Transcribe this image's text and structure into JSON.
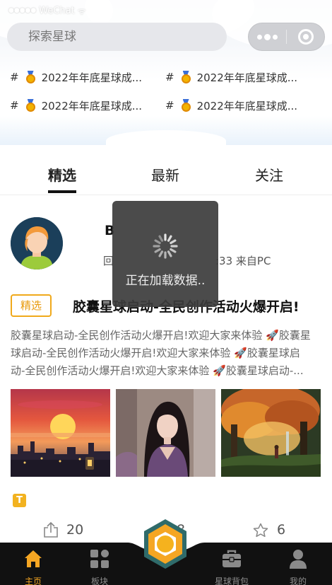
{
  "status_bar": {
    "signal": "●●●●●",
    "carrier": "WeChat",
    "wifi": "ᯤ"
  },
  "search": {
    "placeholder": "探索星球"
  },
  "topics": [
    {
      "hash": "#",
      "text": "2022年年底星球成..."
    },
    {
      "hash": "#",
      "text": "2022年年底星球成..."
    },
    {
      "hash": "#",
      "text": "2022年年底星球成..."
    },
    {
      "hash": "#",
      "text": "2022年年底星球成..."
    }
  ],
  "tabs": [
    {
      "label": "精选",
      "active": true
    },
    {
      "label": "最新",
      "active": false
    },
    {
      "label": "关注",
      "active": false
    }
  ],
  "post": {
    "author": "B",
    "meta_left": "回",
    "meta_right": ":33 来自PC",
    "badge": "精选",
    "title": "胶囊星球启动-全民创作活动火爆开启!",
    "body_lines": [
      "胶囊星球启动-全民创作活动火爆开启!欢迎大家来体验 🚀胶囊星",
      "球启动-全民创作活动火爆开启!欢迎大家来体验 🚀胶囊星球启",
      "动-全民创作活动火爆开启!欢迎大家来体验 🚀胶囊星球启动-..."
    ],
    "tag_icon": "T",
    "share_count": "20",
    "comment_count": "8",
    "like_count": "6"
  },
  "toast": {
    "text": "正在加载数据.."
  },
  "tabbar": [
    {
      "label": "主页",
      "icon": "home-icon",
      "active": true
    },
    {
      "label": "板块",
      "icon": "grid-icon",
      "active": false
    },
    {
      "label": "星球背包",
      "icon": "briefcase-icon",
      "active": false
    },
    {
      "label": "我的",
      "icon": "person-icon",
      "active": false
    }
  ],
  "colors": {
    "accent": "#f5a623",
    "badge_border": "#f0a91b",
    "tabbar_bg": "#111111",
    "toast_bg": "#3c3c3c"
  }
}
